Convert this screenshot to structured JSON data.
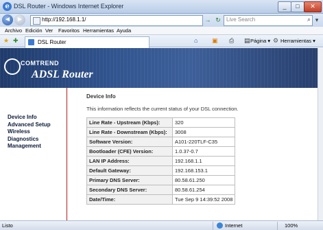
{
  "window": {
    "title": "DSL Router - Windows Internet Explorer",
    "minimize": "_",
    "maximize": "□",
    "close": "✕"
  },
  "addressbar": {
    "back": "◄",
    "forward": "►",
    "url": "http://192.168.1.1/",
    "go": "→",
    "refresh": "↻",
    "stop": "✕",
    "search_placeholder": "Live Search"
  },
  "menu": {
    "items": [
      "Archivo",
      "Edición",
      "Ver",
      "Favoritos",
      "Herramientas",
      "Ayuda"
    ]
  },
  "tab": {
    "label": "DSL Router"
  },
  "toolbar": {
    "page_label": "Página ▾",
    "tools_label": "Herramientas ▾"
  },
  "header": {
    "brand": "COMTREND",
    "product": "ADSL Router"
  },
  "nav": {
    "items": [
      "Device Info",
      "Advanced Setup",
      "Wireless",
      "Diagnostics",
      "Management"
    ]
  },
  "main": {
    "section_title": "Device Info",
    "info_text": "This information reflects the current status of your DSL connection.",
    "rows": [
      {
        "label": "Line Rate - Upstream (Kbps):",
        "value": "320"
      },
      {
        "label": "Line Rate - Downstream (Kbps):",
        "value": "3008"
      },
      {
        "label": "Software Version:",
        "value": "A101-220TLF-C35"
      },
      {
        "label": "Bootloader (CFE) Version:",
        "value": "1.0.37-0.7"
      },
      {
        "label": "LAN IP Address:",
        "value": "192.168.1.1"
      },
      {
        "label": "Default Gateway:",
        "value": "192.168.153.1"
      },
      {
        "label": "Primary DNS Server:",
        "value": "80.58.61.250"
      },
      {
        "label": "Secondary DNS Server:",
        "value": "80.58.61.254"
      },
      {
        "label": "Date/Time:",
        "value": "Tue Sep 9 14:39:52 2008"
      }
    ]
  },
  "status": {
    "text": "Listo",
    "zone": "Internet",
    "zoom": "100%"
  },
  "colors": {
    "header_bg": "#31548f",
    "accent_red": "#b51a1a",
    "nav_text": "#0b1a3a"
  }
}
